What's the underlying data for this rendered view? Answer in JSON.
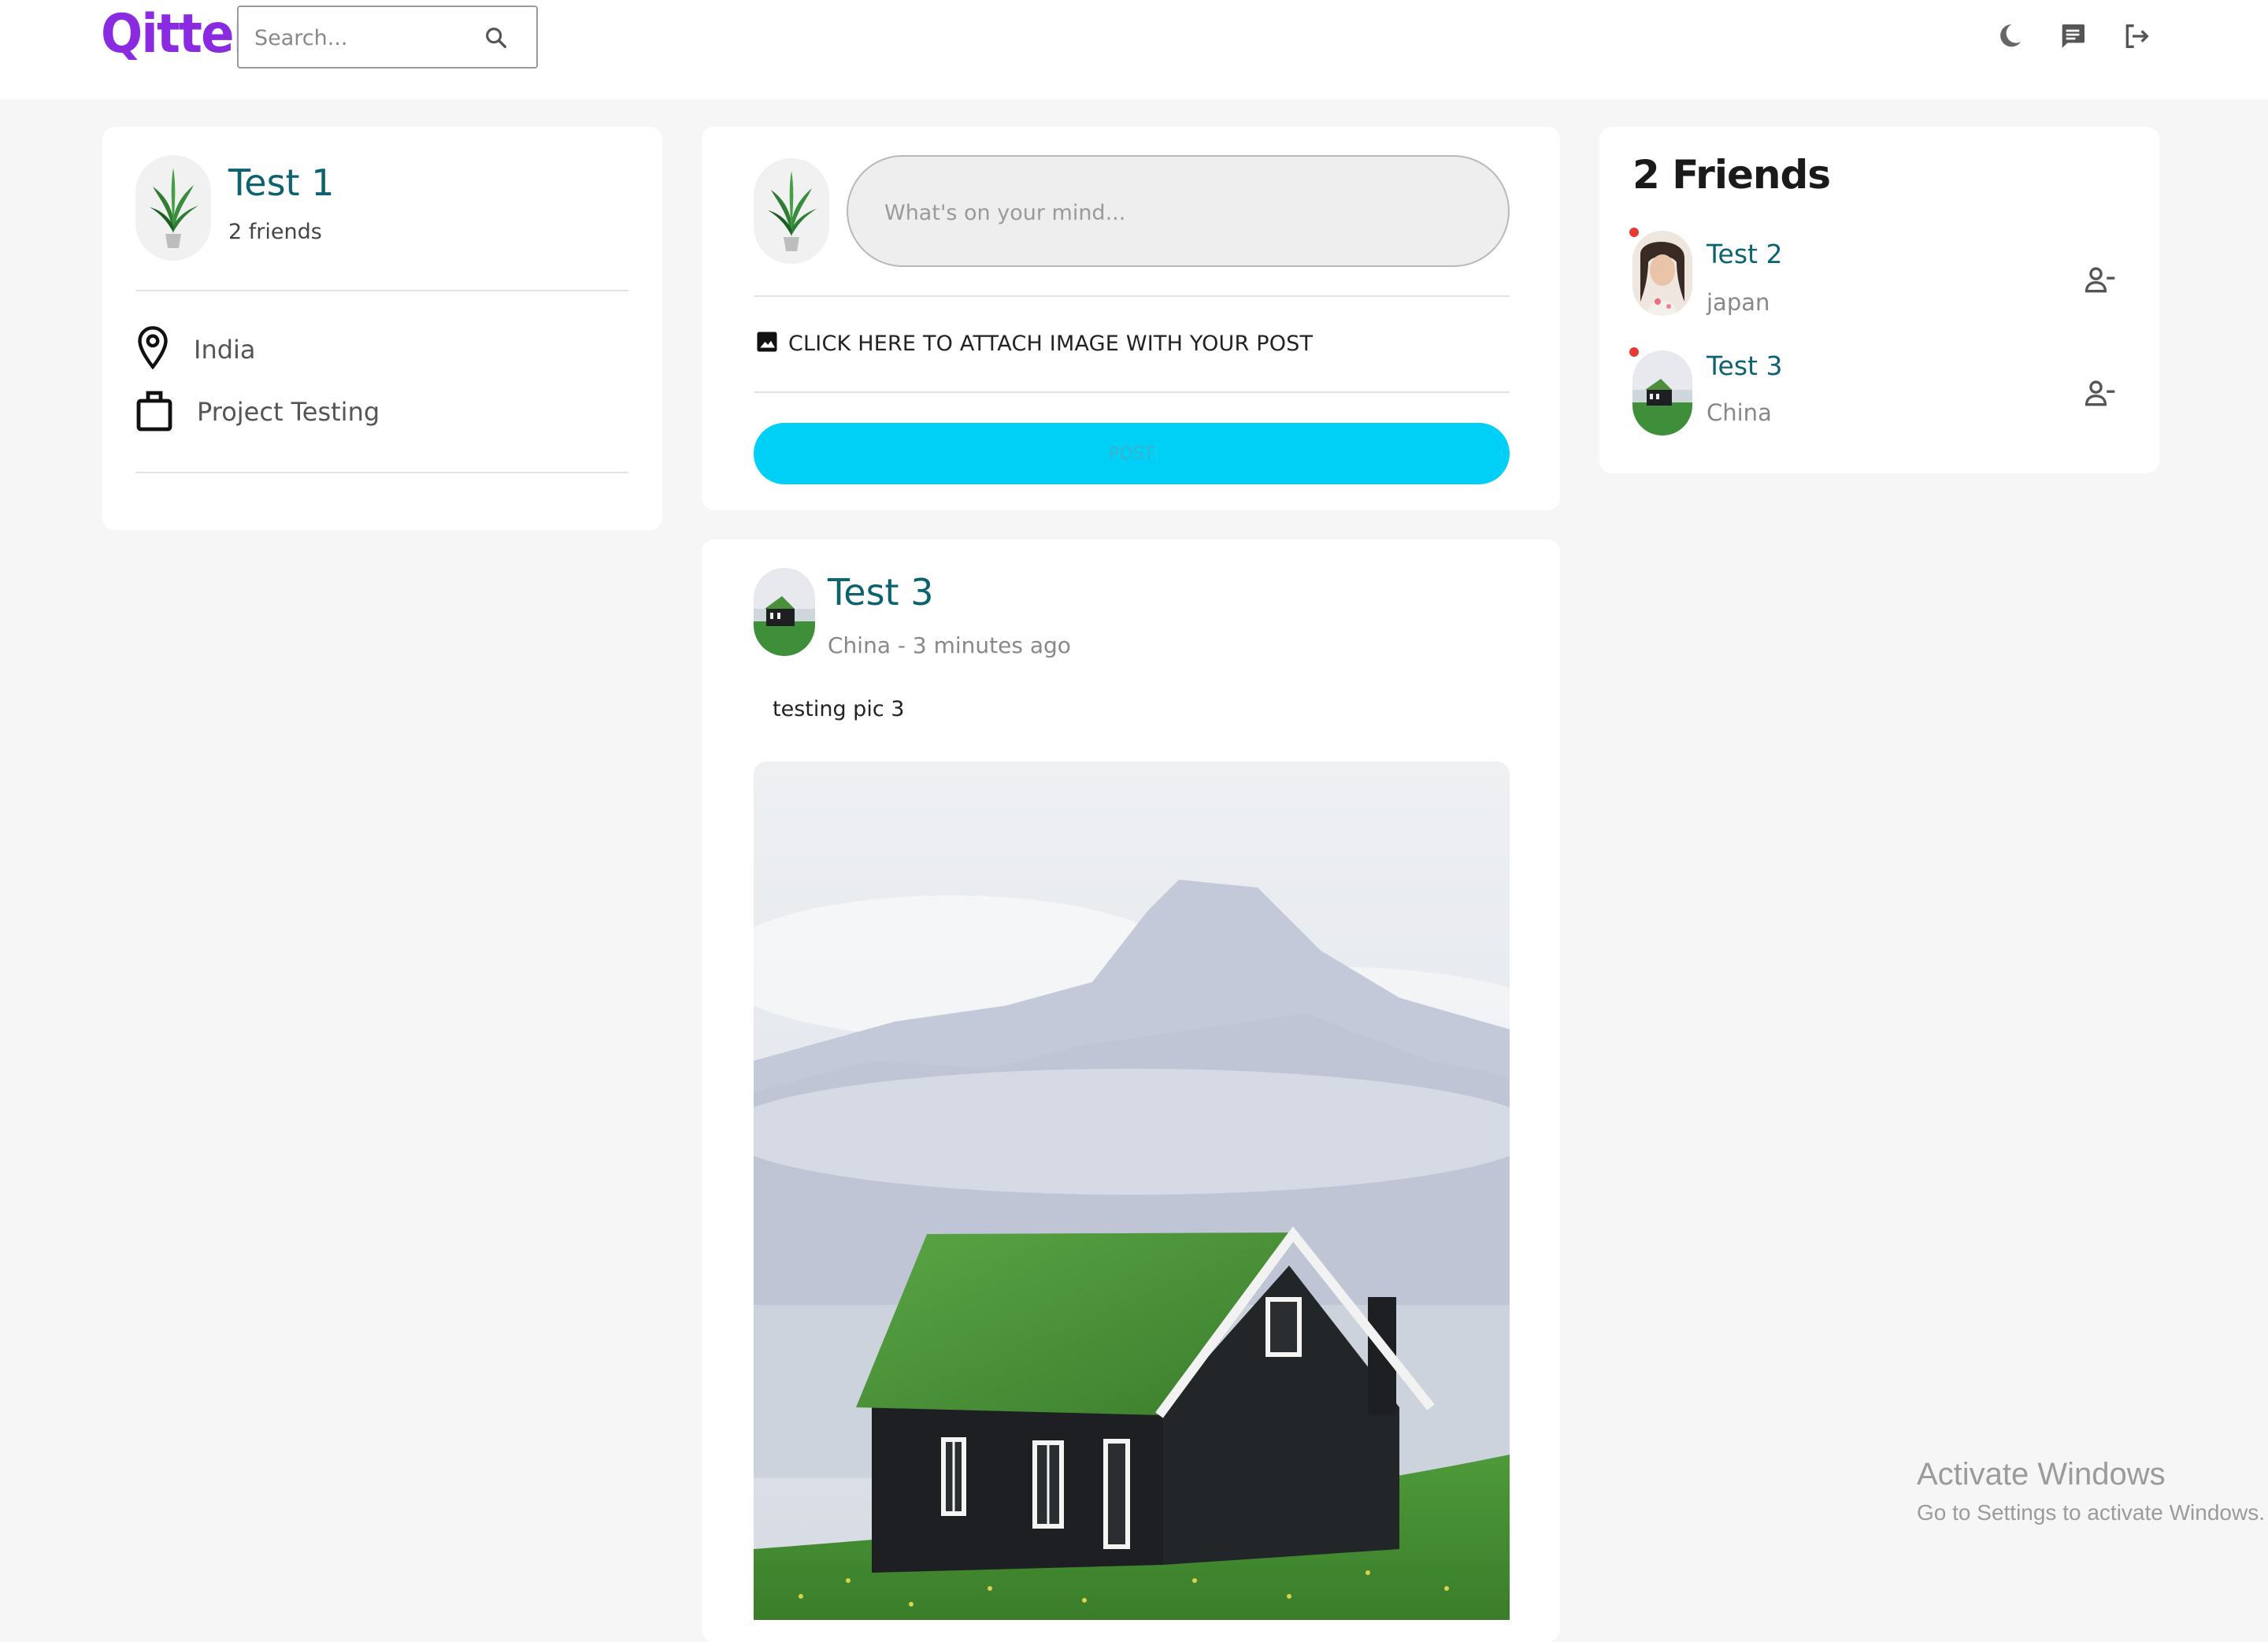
{
  "app": {
    "logo": "Qitter",
    "search_placeholder": "Search...",
    "icons": [
      "moon-icon",
      "chat-icon",
      "logout-icon"
    ]
  },
  "profile": {
    "name": "Test 1",
    "friends": "2 friends",
    "location": "India",
    "occupation": "Project Testing"
  },
  "composer": {
    "placeholder": "What's on your mind...",
    "attach_label": "CLICK HERE TO ATTACH IMAGE WITH YOUR POST",
    "post_label": "POST"
  },
  "friends": {
    "title": "2 Friends",
    "items": [
      {
        "name": "Test 2",
        "location": "japan",
        "online": true
      },
      {
        "name": "Test 3",
        "location": "China",
        "online": true
      }
    ]
  },
  "post": {
    "author": "Test 3",
    "meta": "China - 3 minutes ago",
    "text": "testing pic 3"
  },
  "watermark": {
    "title": "Activate Windows",
    "subtitle": "Go to Settings to activate Windows."
  },
  "colors": {
    "brand": "#8a2be2",
    "name_teal": "#0d6270",
    "post_button": "#00d0f5",
    "online_dot": "#e53935"
  }
}
